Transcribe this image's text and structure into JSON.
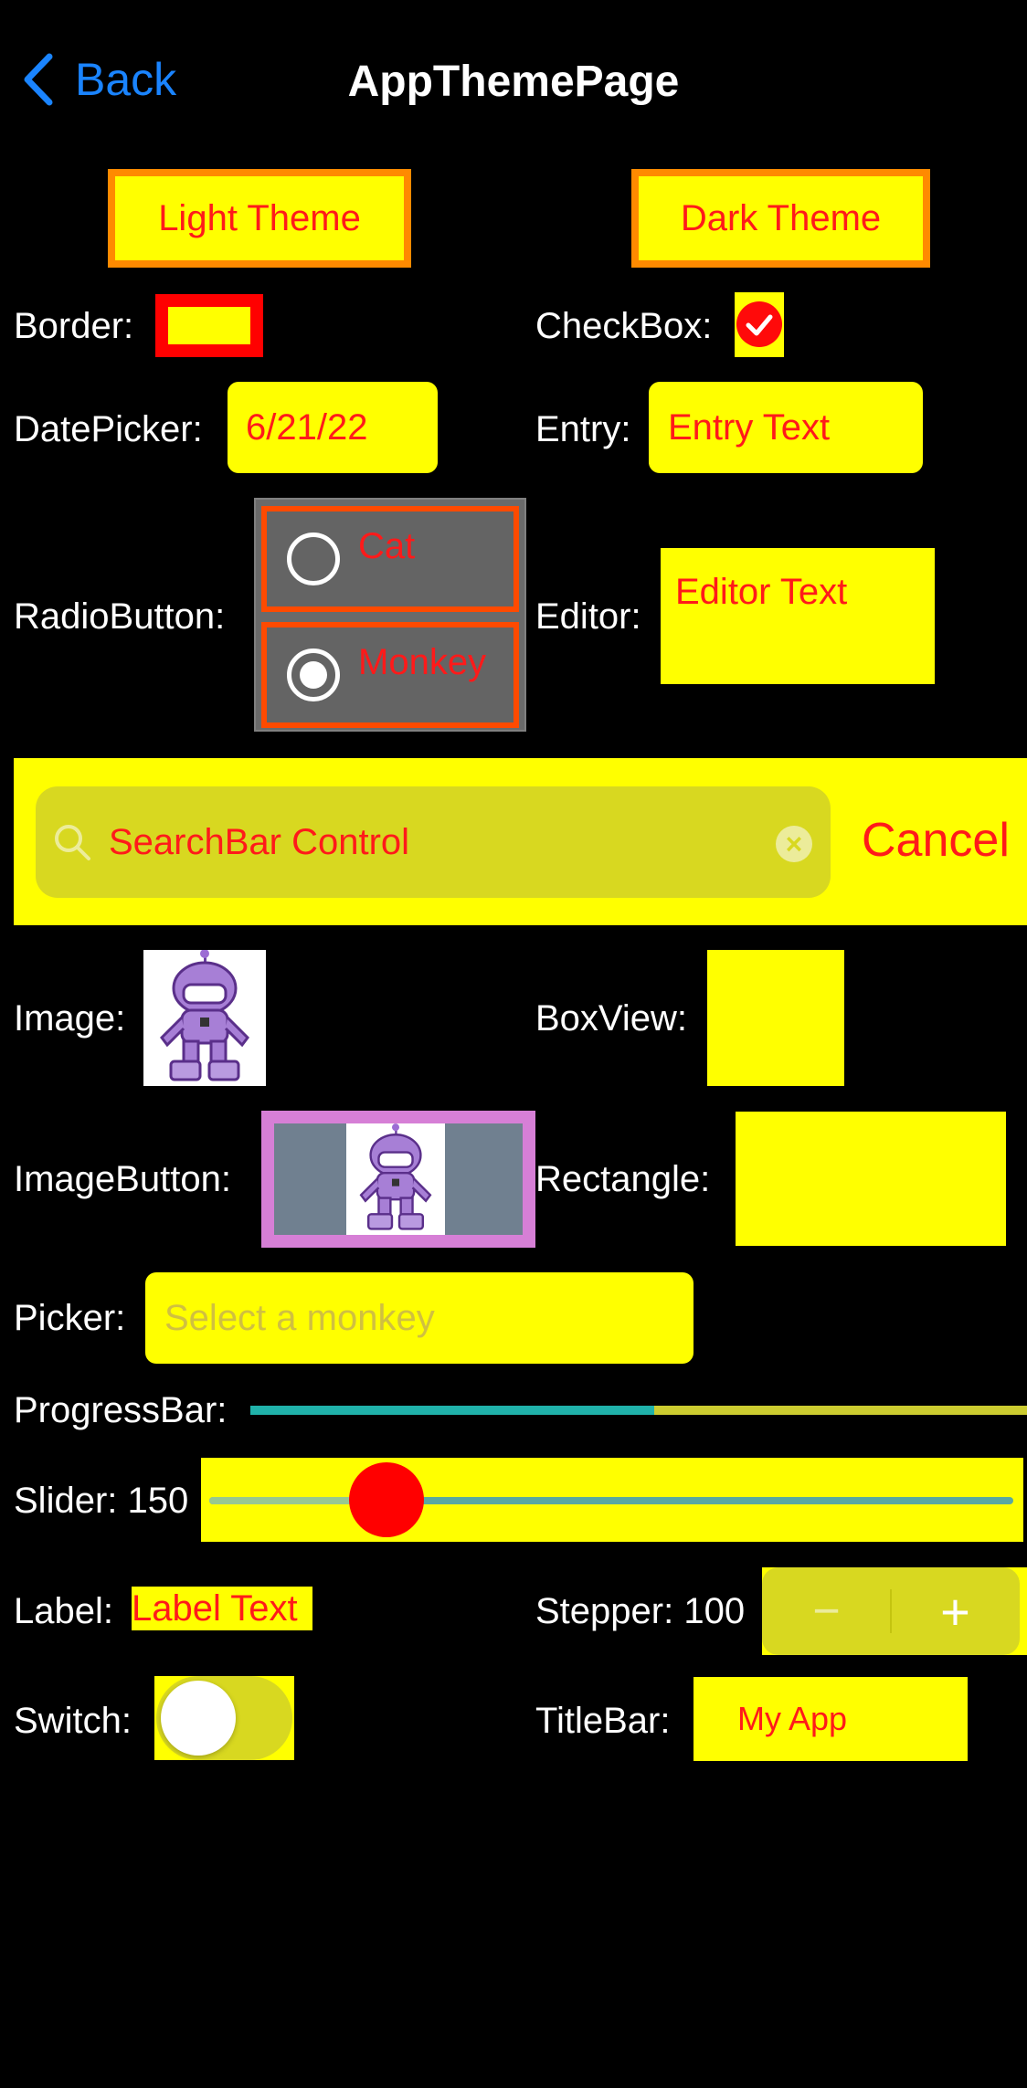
{
  "nav": {
    "back_label": "Back",
    "title": "AppThemePage"
  },
  "theme_buttons": {
    "light": "Light Theme",
    "dark": "Dark Theme"
  },
  "labels": {
    "border": "Border:",
    "checkbox": "CheckBox:",
    "datepicker": "DatePicker:",
    "entry": "Entry:",
    "radiobutton": "RadioButton:",
    "editor": "Editor:",
    "image": "Image:",
    "boxview": "BoxView:",
    "imagebutton": "ImageButton:",
    "rectangle": "Rectangle:",
    "picker": "Picker:",
    "progressbar": "ProgressBar:",
    "slider": "Slider: 150",
    "label": "Label:",
    "stepper": "Stepper: 100",
    "switch": "Switch:",
    "titlebar": "TitleBar:"
  },
  "values": {
    "checkbox_checked": true,
    "date": "6/21/22",
    "entry_text": "Entry Text",
    "editor_text": "Editor Text",
    "radio_options": [
      {
        "label": "Cat",
        "selected": false
      },
      {
        "label": "Monkey",
        "selected": true
      }
    ],
    "search_text": "SearchBar Control",
    "search_cancel": "Cancel",
    "picker_placeholder": "Select a monkey",
    "progress_fraction": 0.52,
    "slider_value": 150,
    "label_text": "Label Text",
    "stepper_value": 100,
    "stepper_minus": "−",
    "stepper_plus": "+",
    "switch_on": false,
    "titlebar_text": "My App"
  },
  "colors": {
    "background": "#000000",
    "control_bg": "#ffff00",
    "text_accent": "#ff1a1a",
    "theme_button_border": "#ff8a00",
    "radio_border": "#ff4a00",
    "imagebutton_border": "#d67fd6",
    "progress_fill": "#20b2aa",
    "back_link": "#1a84ff"
  }
}
